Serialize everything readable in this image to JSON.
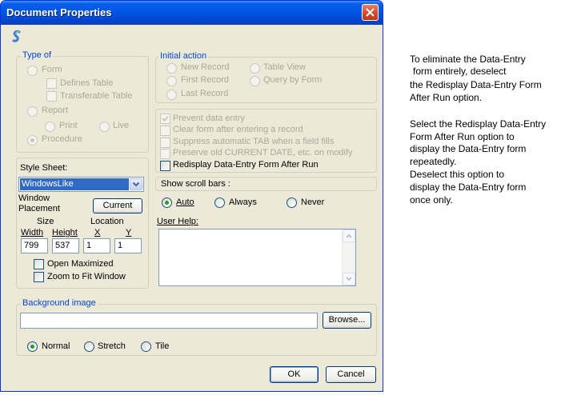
{
  "window": {
    "title": "Document Properties"
  },
  "type_of": {
    "legend": "Type of",
    "form": "Form",
    "defines_table": "Defines Table",
    "transferable_table": "Transferable Table",
    "report": "Report",
    "print": "Print",
    "live": "Live",
    "procedure": "Procedure"
  },
  "initial_action": {
    "legend": "Initial action",
    "new_record": "New Record",
    "table_view": "Table View",
    "first_record": "First Record",
    "query_by_form": "Query by Form",
    "last_record": "Last Record"
  },
  "options": {
    "prevent_data_entry": "Prevent data entry",
    "clear_form": "Clear form after entering a record",
    "suppress_tab": "Suppress automatic TAB when a field fills",
    "preserve_date": "Preserve old CURRENT DATE, etc. on modify",
    "redisplay": "Redisplay Data-Entry Form After Run"
  },
  "style_sheet": {
    "label": "Style Sheet:",
    "selected": "WindowsLike"
  },
  "window_placement": {
    "label_line1": "Window",
    "label_line2": "Placement",
    "current_button": "Current",
    "size_label": "Size",
    "location_label": "Location",
    "width_label": "Width",
    "height_label": "Height",
    "x_label": "X",
    "y_label": "Y",
    "width_value": "799",
    "height_value": "537",
    "x_value": "1",
    "y_value": "1",
    "open_maximized": "Open Maximized",
    "zoom_to_fit": "Zoom to Fit Window"
  },
  "scroll_bars": {
    "label": "Show scroll bars :",
    "auto": "Auto",
    "always": "Always",
    "never": "Never"
  },
  "user_help": {
    "label": "User Help:",
    "value": ""
  },
  "background_image": {
    "legend": "Background image",
    "path": "",
    "browse_button": "Browse...",
    "normal": "Normal",
    "stretch": "Stretch",
    "tile": "Tile"
  },
  "footer": {
    "ok": "OK",
    "cancel": "Cancel"
  },
  "side_note": {
    "p1": [
      "To eliminate the  Data-Entry",
      "form entirely, deselect",
      "the Redisplay Data-Entry Form",
      "After Run option."
    ],
    "p2": [
      "Select the Redisplay Data-Entry",
      "Form After Run option to",
      "display the Data-Entry form",
      "repeatedly.",
      "Deselect this option to",
      "display the Data-Entry form",
      "once only."
    ]
  }
}
